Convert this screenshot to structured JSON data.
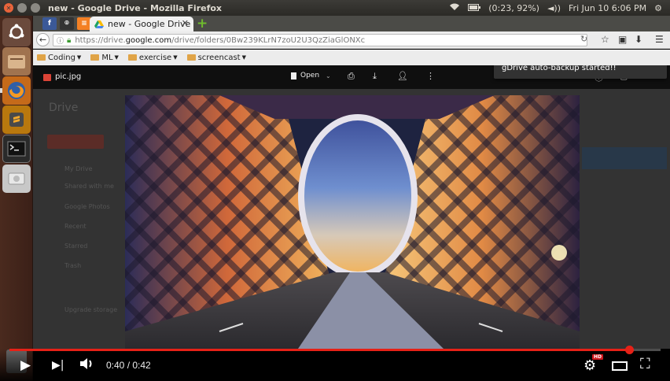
{
  "system": {
    "window_title": "new - Google Drive - Mozilla Firefox",
    "battery": "(0:23, 92%)",
    "clock": "Fri Jun 10  6:06 PM"
  },
  "browser": {
    "active_tab_title": "new - Google Drive",
    "url_prefix": "https://drive.",
    "url_domain": "google.com",
    "url_path": "/drive/folders/0Bw239KLrN7zoU2U3QzZiaGlONXc",
    "bookmarks": [
      {
        "label": "Coding"
      },
      {
        "label": "ML"
      },
      {
        "label": "exercise"
      },
      {
        "label": "screencast"
      }
    ]
  },
  "viewer": {
    "file_name": "pic.jpg",
    "open_label": "Open",
    "toast_text": "gDrive auto-backup started!!",
    "background": {
      "logo": "Drive",
      "sidebar": [
        "My Drive",
        "Shared with me",
        "Google Photos",
        "Recent",
        "Starred",
        "Trash"
      ],
      "storage": "Upgrade storage"
    }
  },
  "video": {
    "time_display": "0:40 / 0:42",
    "progress": 0.952,
    "hd_label": "HD",
    "accent": "#e62117"
  }
}
